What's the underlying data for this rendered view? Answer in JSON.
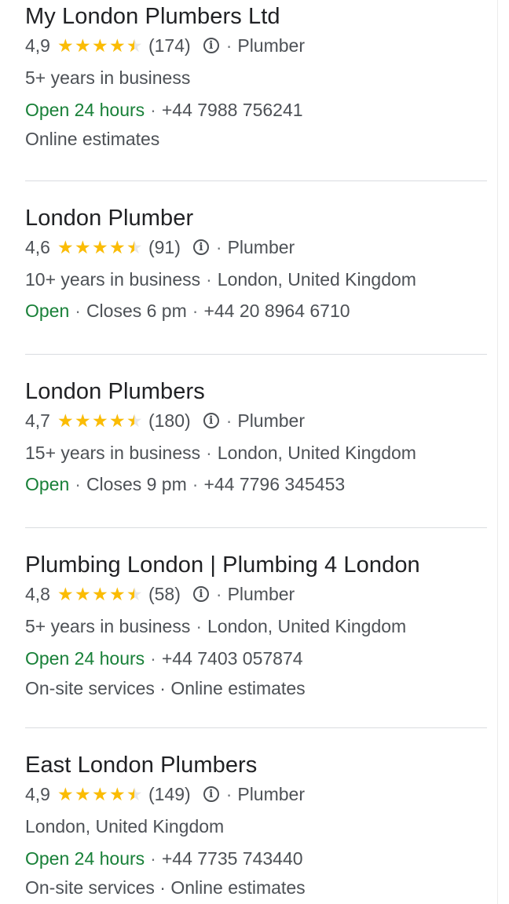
{
  "listings": [
    {
      "name": "My London Plumbers Ltd",
      "rating": "4,9",
      "rating_value": 4.9,
      "reviews": "(174)",
      "category": "Plumber",
      "details": "5+ years in business",
      "location": "",
      "status": "Open 24 hours",
      "closes": "",
      "phone": "+44 7988 756241",
      "services": "Online estimates"
    },
    {
      "name": "London Plumber",
      "rating": "4,6",
      "rating_value": 4.6,
      "reviews": "(91)",
      "category": "Plumber",
      "details": "10+ years in business",
      "location": "London, United Kingdom",
      "status": "Open",
      "closes": "Closes 6 pm",
      "phone": "+44 20 8964 6710",
      "services": ""
    },
    {
      "name": "London Plumbers",
      "rating": "4,7",
      "rating_value": 4.7,
      "reviews": "(180)",
      "category": "Plumber",
      "details": "15+ years in business",
      "location": "London, United Kingdom",
      "status": "Open",
      "closes": "Closes 9 pm",
      "phone": "+44 7796 345453",
      "services": ""
    },
    {
      "name": "Plumbing London | Plumbing 4 London",
      "rating": "4,8",
      "rating_value": 4.8,
      "reviews": "(58)",
      "category": "Plumber",
      "details": "5+ years in business",
      "location": "London, United Kingdom",
      "status": "Open 24 hours",
      "closes": "",
      "phone": "+44 7403 057874",
      "services": "On-site services · Online estimates"
    },
    {
      "name": "East London Plumbers",
      "rating": "4,9",
      "rating_value": 4.9,
      "reviews": "(149)",
      "category": "Plumber",
      "details": "",
      "location": "London, United Kingdom",
      "status": "Open 24 hours",
      "closes": "",
      "phone": "+44 7735 743440",
      "services": "On-site services · Online estimates"
    }
  ],
  "icons": {
    "star": "star-icon",
    "info": "info-icon"
  },
  "colors": {
    "star_fill": "#fbbc04",
    "open_status": "#188038",
    "title": "#202124"
  }
}
